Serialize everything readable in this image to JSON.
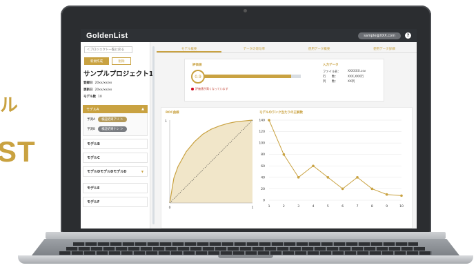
{
  "background_text": {
    "line1": "ル",
    "line2": "ST"
  },
  "app": {
    "logo": "GoldenList",
    "user_email": "sample@XXX.com",
    "help_icon": "question-circle-icon"
  },
  "sidebar": {
    "back_label": "＜プロジェクト一覧に戻る",
    "new_label": "新規作成",
    "delete_label": "削除",
    "project_title": "サンプルプロジェクト1",
    "registered_label": "登録日",
    "registered_value": "20xx/xx/xx",
    "updated_label": "更新日",
    "updated_value": "20xx/xx/xx",
    "model_count_label": "モデル数",
    "model_count_value": "10",
    "models": [
      {
        "label": "モデルA",
        "state": "expanded"
      },
      {
        "label": "モデルB"
      },
      {
        "label": "モデルC"
      },
      {
        "label": "モデルDモデルDモデルD",
        "state": "collapsed"
      },
      {
        "label": "モデルE"
      },
      {
        "label": "モデルF"
      }
    ],
    "sub_rows": [
      {
        "label": "予測A",
        "pill": "検証結果アリ ＞"
      },
      {
        "label": "予測B",
        "pill": "検証結果ナシ ＞"
      }
    ]
  },
  "tabs": [
    "モデル概要",
    "データの寄与率",
    "使用データ概要",
    "使用データ詳細"
  ],
  "active_tab": 0,
  "evaluation": {
    "label": "評価値",
    "value": "0.9",
    "fill_fraction": 0.9,
    "warning": "評価値が高くなっています"
  },
  "input_data": {
    "title": "入力データ",
    "rows": [
      {
        "key": "ファイル名：",
        "value": "XXXXXX.csv"
      },
      {
        "key": "行　　数：",
        "value": "XXX,XXX行"
      },
      {
        "key": "列　　数：",
        "value": "XX列"
      }
    ]
  },
  "chart_data": [
    {
      "type": "line",
      "title": "ROC曲線",
      "x_ticks": [
        "0",
        "1"
      ],
      "y_ticks": [
        "1"
      ],
      "xlim": [
        0,
        1
      ],
      "ylim": [
        0,
        1
      ],
      "series": [
        {
          "x": [
            0,
            0.05,
            0.1,
            0.2,
            0.3,
            0.4,
            0.5,
            0.6,
            0.7,
            0.8,
            0.9,
            1.0
          ],
          "values": [
            0,
            0.3,
            0.44,
            0.62,
            0.74,
            0.83,
            0.89,
            0.93,
            0.96,
            0.98,
            0.99,
            1.0
          ]
        },
        {
          "x": [
            0,
            1
          ],
          "values": [
            0,
            1
          ]
        }
      ],
      "fill": "area-under-curve",
      "colors": {
        "line": "#c9a241",
        "fill": "#f1e6c9",
        "diagonal": "#333333"
      }
    },
    {
      "type": "line",
      "title": "モデルのランク当たりの正解数",
      "categories": [
        "1",
        "2",
        "3",
        "4",
        "5",
        "6",
        "7",
        "8",
        "9",
        "10"
      ],
      "values": [
        140,
        80,
        40,
        60,
        40,
        20,
        40,
        20,
        10,
        8
      ],
      "y_ticks": [
        "0",
        "20",
        "40",
        "60",
        "80",
        "100",
        "120",
        "140"
      ],
      "ylim": [
        0,
        140
      ],
      "colors": {
        "line": "#c9a241",
        "grid": "#dddddd"
      }
    }
  ]
}
